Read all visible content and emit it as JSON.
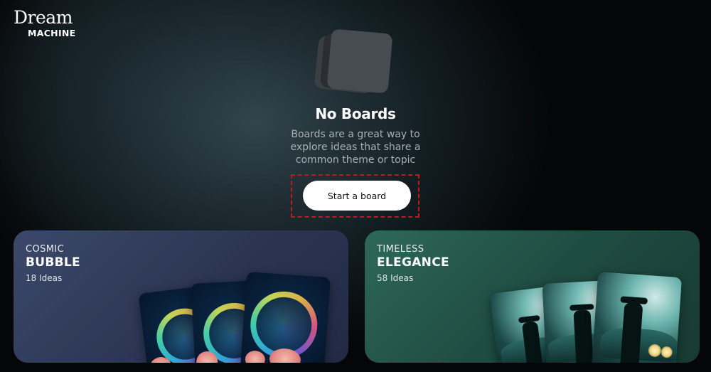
{
  "brand": {
    "script": "Dream",
    "word": "MACHINE"
  },
  "empty_state": {
    "icon": "stacked-cards-icon",
    "title": "No Boards",
    "description": "Boards are a great way to explore ideas that share a common theme or topic",
    "button_label": "Start a board"
  },
  "boards": [
    {
      "kicker": "COSMIC",
      "title": "BUBBLE",
      "count": "18 Ideas",
      "color": "#34405e"
    },
    {
      "kicker": "TIMELESS",
      "title": "ELEGANCE",
      "count": "58 Ideas",
      "color": "#255a4d"
    }
  ],
  "colors": {
    "highlight_border": "#c5161a",
    "button_bg": "#ffffff"
  }
}
